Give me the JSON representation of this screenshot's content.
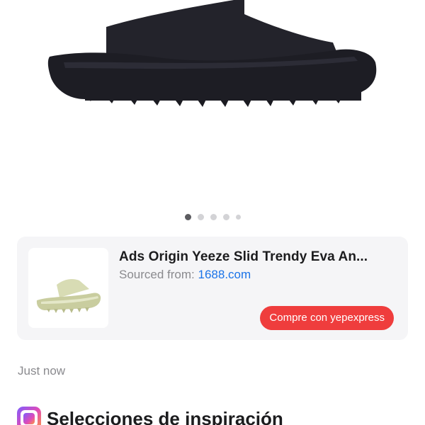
{
  "carousel": {
    "total_images": 5,
    "active_index": 0,
    "hero_image": "black-slide-sandal-image"
  },
  "product_card": {
    "thumbnail": "green-slide-sandal-thumbnail",
    "title": "Ads Origin Yeeze Slid Trendy Eva An...",
    "sourced_label": "Sourced from:",
    "source_link": "1688.com",
    "buy_button_label": "Compre con yepexpress",
    "colors": {
      "card_bg": "#f5f5f7",
      "link": "#1a73e8",
      "button": "#ef3d3d"
    }
  },
  "message": {
    "timestamp": "Just now"
  },
  "section": {
    "icon": "inspiration-app-icon",
    "title": "Selecciones de inspiración"
  }
}
